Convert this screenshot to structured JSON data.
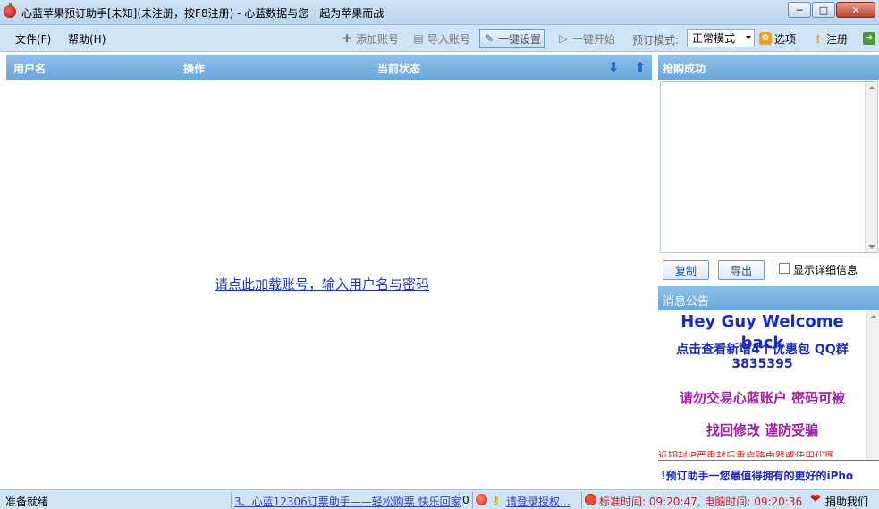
{
  "window": {
    "title": "心蓝苹果预订助手[未知](未注册，按F8注册) - 心蓝数据与您一起为苹果而战",
    "minimize": "─",
    "maximize": "□",
    "close": "✕"
  },
  "menu": {
    "file": "文件(F)",
    "help": "帮助(H)"
  },
  "toolbar": {
    "add_account": "添加账号",
    "import_account": "导入账号",
    "one_click_settings": "一键设置",
    "one_click_start": "一键开始",
    "mode_label": "预订模式:",
    "mode_value": "正常模式",
    "options": "选项",
    "register": "注册"
  },
  "table": {
    "col_username": "用户名",
    "col_action": "操作",
    "col_status": "当前状态",
    "load_prompt": "请点此加载账号，输入用户名与密码"
  },
  "right": {
    "success_header": "抢购成功",
    "copy_button": "复制",
    "export_button": "导出",
    "show_details": "显示详细信息",
    "news_header": "消息公告",
    "news": {
      "line1": "Hey Guy Welcome back",
      "line2": "点击查看新增4个优惠包  QQ群3835395",
      "line3": "请勿交易心蓝账户  密码可被",
      "line4": "找回修改  谨防受骗",
      "line5": "近期封IP严重封后重启路由器或使用代理",
      "marquee": "!预订助手一您最值得拥有的更好的iPho"
    }
  },
  "status": {
    "ready": "准备就绪",
    "promo": "3、心蓝12306订票助手——轻松购票 快乐回家",
    "count": "0",
    "login_auth": "请登录授权...",
    "time_text": "标准时间: 09:20:47, 电脑时间: 09:20:36",
    "donate": "捐助我们"
  },
  "colors": {
    "header_blue": "#6aa6dc",
    "link_blue": "#2030c0",
    "purple": "#a020a0",
    "red": "#d02020"
  }
}
